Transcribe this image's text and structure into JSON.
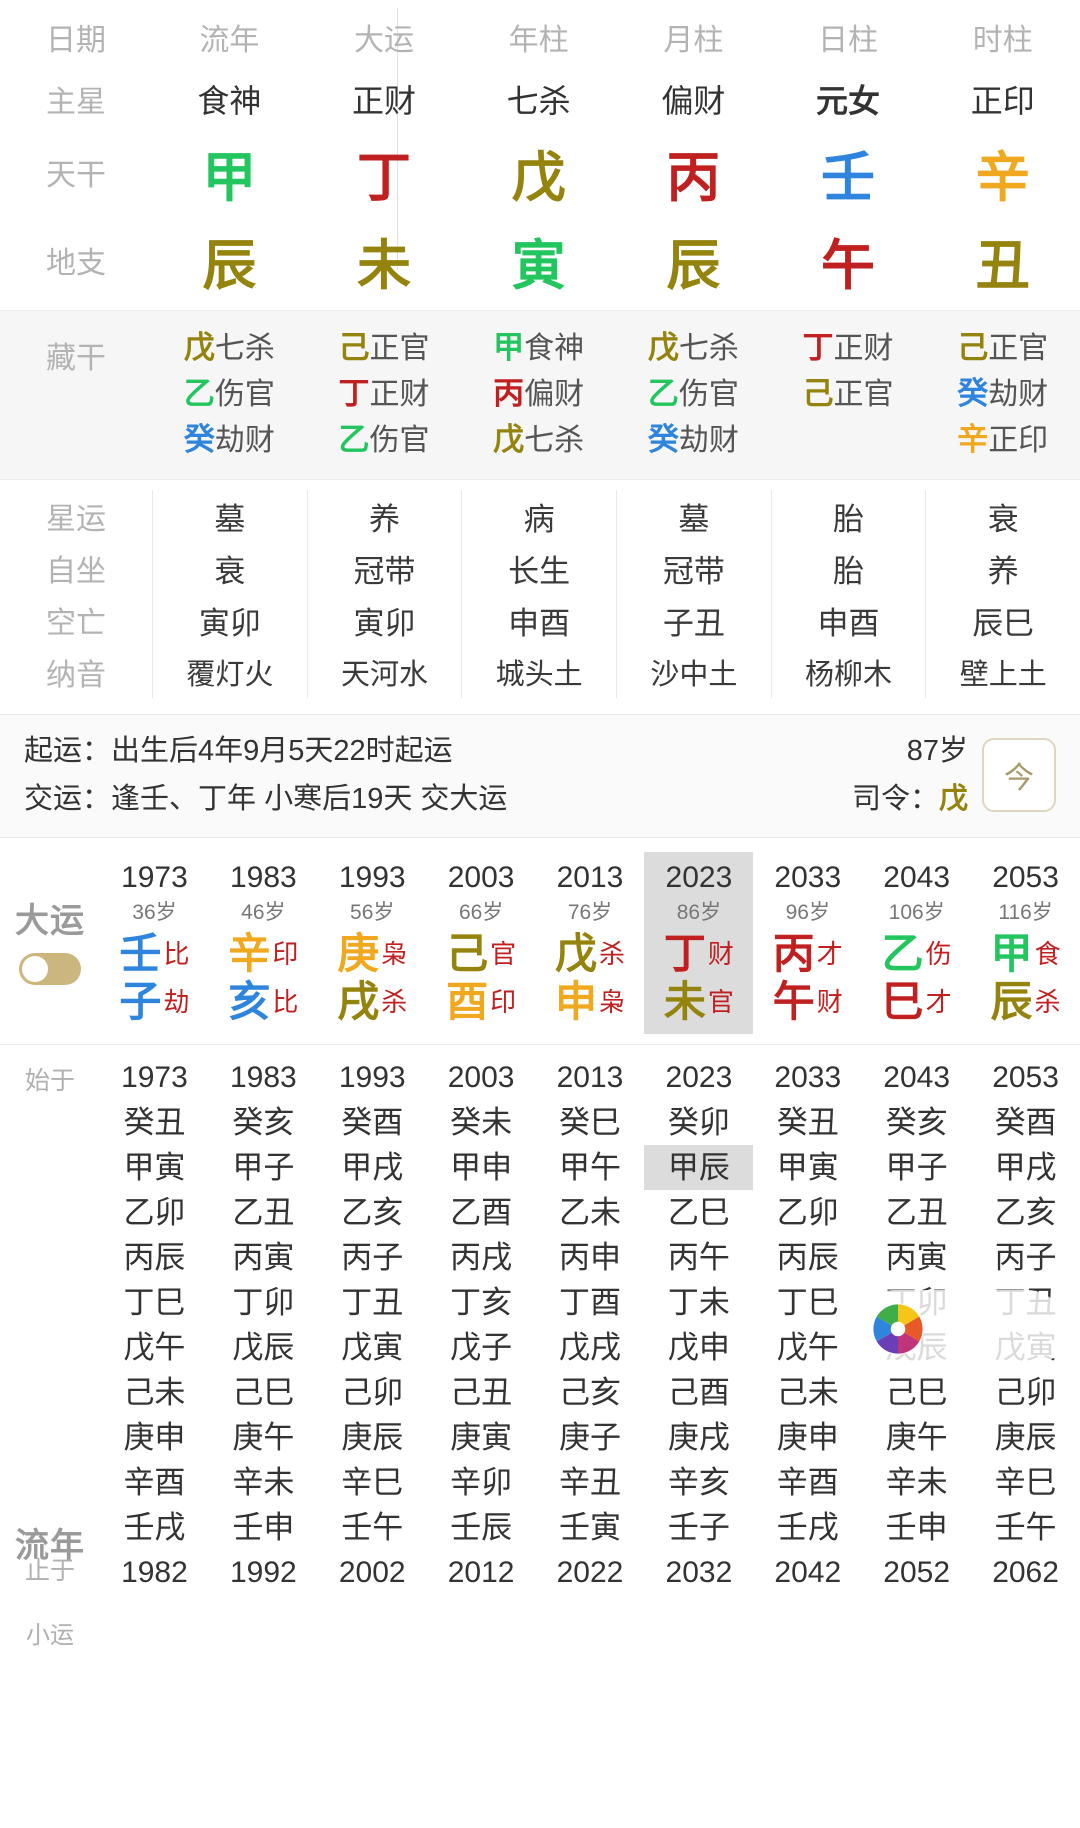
{
  "pillar_table": {
    "row_labels": [
      "日期",
      "主星",
      "天干",
      "地支"
    ],
    "columns": [
      {
        "header": "流年",
        "main_star": "食神",
        "stem": "甲",
        "stem_el": "wood",
        "branch": "辰",
        "branch_el": "earth",
        "bold_star": false
      },
      {
        "header": "大运",
        "main_star": "正财",
        "stem": "丁",
        "stem_el": "fire",
        "branch": "未",
        "branch_el": "earth",
        "bold_star": false
      },
      {
        "header": "年柱",
        "main_star": "七杀",
        "stem": "戊",
        "stem_el": "earth",
        "branch": "寅",
        "branch_el": "wood",
        "bold_star": false
      },
      {
        "header": "月柱",
        "main_star": "偏财",
        "stem": "丙",
        "stem_el": "fire",
        "branch": "辰",
        "branch_el": "earth",
        "bold_star": false
      },
      {
        "header": "日柱",
        "main_star": "元女",
        "stem": "壬",
        "stem_el": "water",
        "branch": "午",
        "branch_el": "fire",
        "bold_star": true
      },
      {
        "header": "时柱",
        "main_star": "正印",
        "stem": "辛",
        "stem_el": "metal",
        "branch": "丑",
        "branch_el": "earth",
        "bold_star": false
      }
    ]
  },
  "hidden_stems": {
    "label": "藏干",
    "columns": [
      [
        {
          "stem": "戊",
          "el": "earth",
          "star": "七杀"
        },
        {
          "stem": "乙",
          "el": "wood",
          "star": "伤官"
        },
        {
          "stem": "癸",
          "el": "water",
          "star": "劫财"
        }
      ],
      [
        {
          "stem": "己",
          "el": "earth",
          "star": "正官"
        },
        {
          "stem": "丁",
          "el": "fire",
          "star": "正财"
        },
        {
          "stem": "乙",
          "el": "wood",
          "star": "伤官"
        }
      ],
      [
        {
          "stem": "甲",
          "el": "wood",
          "star": "食神"
        },
        {
          "stem": "丙",
          "el": "fire",
          "star": "偏财"
        },
        {
          "stem": "戊",
          "el": "earth",
          "star": "七杀"
        }
      ],
      [
        {
          "stem": "戊",
          "el": "earth",
          "star": "七杀"
        },
        {
          "stem": "乙",
          "el": "wood",
          "star": "伤官"
        },
        {
          "stem": "癸",
          "el": "water",
          "star": "劫财"
        }
      ],
      [
        {
          "stem": "丁",
          "el": "fire",
          "star": "正财"
        },
        {
          "stem": "己",
          "el": "earth",
          "star": "正官"
        }
      ],
      [
        {
          "stem": "己",
          "el": "earth",
          "star": "正官"
        },
        {
          "stem": "癸",
          "el": "water",
          "star": "劫财"
        },
        {
          "stem": "辛",
          "el": "metal",
          "star": "正印"
        }
      ]
    ]
  },
  "fate_rows": [
    {
      "label": "星运",
      "values": [
        "墓",
        "养",
        "病",
        "墓",
        "胎",
        "衰"
      ]
    },
    {
      "label": "自坐",
      "values": [
        "衰",
        "冠带",
        "长生",
        "冠带",
        "胎",
        "养"
      ]
    },
    {
      "label": "空亡",
      "values": [
        "寅卯",
        "寅卯",
        "申酉",
        "子丑",
        "申酉",
        "辰巳"
      ]
    },
    {
      "label": "纳音",
      "values": [
        "覆灯火",
        "天河水",
        "城头土",
        "沙中土",
        "杨柳木",
        "壁上土"
      ]
    }
  ],
  "info_band": {
    "qiyun_label": "起运：",
    "qiyun_value": "出生后4年9月5天22时起运",
    "jiaoyun_label": "交运：",
    "jiaoyun_value": "逢壬、丁年 小寒后19天 交大运",
    "age": "87岁",
    "siling_label": "司令：",
    "siling_value": "戊",
    "siling_el": "earth",
    "calendar_icon_label": "今"
  },
  "dayun": {
    "title": "大运",
    "columns": [
      {
        "year": "1973",
        "age": "36岁",
        "stem": "壬",
        "stem_el": "water",
        "stem_star": "比",
        "branch": "子",
        "branch_el": "water",
        "branch_star": "劫",
        "active": false
      },
      {
        "year": "1983",
        "age": "46岁",
        "stem": "辛",
        "stem_el": "metal",
        "stem_star": "印",
        "branch": "亥",
        "branch_el": "water",
        "branch_star": "比",
        "active": false
      },
      {
        "year": "1993",
        "age": "56岁",
        "stem": "庚",
        "stem_el": "metal",
        "stem_star": "枭",
        "branch": "戌",
        "branch_el": "earth",
        "branch_star": "杀",
        "active": false
      },
      {
        "year": "2003",
        "age": "66岁",
        "stem": "己",
        "stem_el": "earth",
        "stem_star": "官",
        "branch": "酉",
        "branch_el": "metal",
        "branch_star": "印",
        "active": false
      },
      {
        "year": "2013",
        "age": "76岁",
        "stem": "戊",
        "stem_el": "earth",
        "stem_star": "杀",
        "branch": "申",
        "branch_el": "metal",
        "branch_star": "枭",
        "active": false
      },
      {
        "year": "2023",
        "age": "86岁",
        "stem": "丁",
        "stem_el": "fire",
        "stem_star": "财",
        "branch": "未",
        "branch_el": "earth",
        "branch_star": "官",
        "active": true
      },
      {
        "year": "2033",
        "age": "96岁",
        "stem": "丙",
        "stem_el": "fire",
        "stem_star": "才",
        "branch": "午",
        "branch_el": "fire",
        "branch_star": "财",
        "active": false
      },
      {
        "year": "2043",
        "age": "106岁",
        "stem": "乙",
        "stem_el": "wood",
        "stem_star": "伤",
        "branch": "巳",
        "branch_el": "fire",
        "branch_star": "才",
        "active": false
      },
      {
        "year": "2053",
        "age": "116岁",
        "stem": "甲",
        "stem_el": "wood",
        "stem_star": "食",
        "branch": "辰",
        "branch_el": "earth",
        "branch_star": "杀",
        "active": false
      }
    ]
  },
  "liunian": {
    "title": "流年",
    "subtitle": "小运",
    "start_label": "始于",
    "end_label": "止于",
    "columns": [
      {
        "start": "1973",
        "cells": [
          "癸丑",
          "甲寅",
          "乙卯",
          "丙辰",
          "丁巳",
          "戊午",
          "己未",
          "庚申",
          "辛酉",
          "壬戌"
        ],
        "end": "1982",
        "highlight": -1
      },
      {
        "start": "1983",
        "cells": [
          "癸亥",
          "甲子",
          "乙丑",
          "丙寅",
          "丁卯",
          "戊辰",
          "己巳",
          "庚午",
          "辛未",
          "壬申"
        ],
        "end": "1992",
        "highlight": -1
      },
      {
        "start": "1993",
        "cells": [
          "癸酉",
          "甲戌",
          "乙亥",
          "丙子",
          "丁丑",
          "戊寅",
          "己卯",
          "庚辰",
          "辛巳",
          "壬午"
        ],
        "end": "2002",
        "highlight": -1
      },
      {
        "start": "2003",
        "cells": [
          "癸未",
          "甲申",
          "乙酉",
          "丙戌",
          "丁亥",
          "戊子",
          "己丑",
          "庚寅",
          "辛卯",
          "壬辰"
        ],
        "end": "2012",
        "highlight": -1
      },
      {
        "start": "2013",
        "cells": [
          "癸巳",
          "甲午",
          "乙未",
          "丙申",
          "丁酉",
          "戊戌",
          "己亥",
          "庚子",
          "辛丑",
          "壬寅"
        ],
        "end": "2022",
        "highlight": -1
      },
      {
        "start": "2023",
        "cells": [
          "癸卯",
          "甲辰",
          "乙巳",
          "丙午",
          "丁未",
          "戊申",
          "己酉",
          "庚戌",
          "辛亥",
          "壬子"
        ],
        "end": "2032",
        "highlight": 1
      },
      {
        "start": "2033",
        "cells": [
          "癸丑",
          "甲寅",
          "乙卯",
          "丙辰",
          "丁巳",
          "戊午",
          "己未",
          "庚申",
          "辛酉",
          "壬戌"
        ],
        "end": "2042",
        "highlight": -1
      },
      {
        "start": "2043",
        "cells": [
          "癸亥",
          "甲子",
          "乙丑",
          "丙寅",
          "丁卯",
          "戊辰",
          "己巳",
          "庚午",
          "辛未",
          "壬申"
        ],
        "end": "2052",
        "highlight": -1
      },
      {
        "start": "2053",
        "cells": [
          "癸酉",
          "甲戌",
          "乙亥",
          "丙子",
          "丁丑",
          "戊寅",
          "己卯",
          "庚辰",
          "辛巳",
          "壬午"
        ],
        "end": "2062",
        "highlight": -1
      }
    ]
  }
}
